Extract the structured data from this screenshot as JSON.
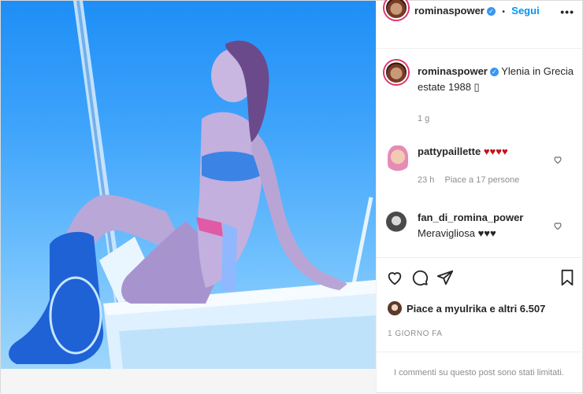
{
  "header": {
    "username": "rominaspower",
    "separator": "•",
    "follow_label": "Segui",
    "more_label": "•••"
  },
  "caption": {
    "username": "rominaspower",
    "text": "Ylenia in Grecia estate 1988 ▯",
    "time": "1 g"
  },
  "comments": [
    {
      "username": "pattypaillette",
      "text": "♥♥♥♥",
      "time": "23 h",
      "likes": "Piace a 17 persone"
    },
    {
      "username": "fan_di_romina_power",
      "text": "Meravigliosa ♥♥♥"
    }
  ],
  "likes_text": "Piace a myulrika e altri 6.507",
  "date_label": "1 GIORNO FA",
  "comments_limited": "I commenti su questo post sono stati limitati.",
  "icons": {
    "verified": "verified-badge-icon",
    "like": "heart-icon",
    "comment": "speech-bubble-icon",
    "share": "paper-plane-icon",
    "save": "bookmark-icon"
  },
  "colors": {
    "accent": "#0095f6",
    "heart_red": "#c0141b",
    "sky": "#3fa4fb"
  }
}
